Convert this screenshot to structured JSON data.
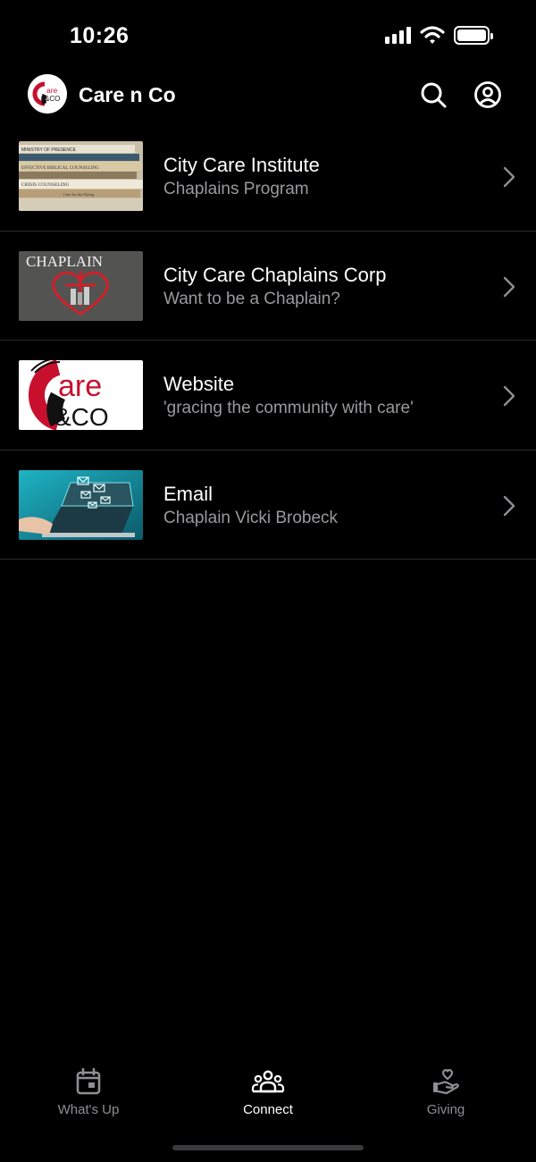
{
  "status_bar": {
    "time": "10:26"
  },
  "header": {
    "app_name": "Care n Co",
    "logo_text_top": "are",
    "logo_text_bottom": "&CO"
  },
  "list": [
    {
      "title": "City Care Institute",
      "subtitle": "Chaplains Program",
      "thumbnail": "books-stack"
    },
    {
      "title": "City Care Chaplains Corp",
      "subtitle": "Want to be a Chaplain?",
      "thumbnail": "chaplain-heart",
      "thumb_text": "CHAPLAIN"
    },
    {
      "title": "Website",
      "subtitle": "'gracing the community with care'",
      "thumbnail": "care-and-co-logo",
      "thumb_text_top": "are",
      "thumb_text_bottom": "&CO"
    },
    {
      "title": "Email",
      "subtitle": "Chaplain Vicki Brobeck",
      "thumbnail": "laptop-email"
    }
  ],
  "books": [
    "MINISTRY OF PRESENCE",
    "EFFECTIVE BIBLICAL COUNSELING",
    "CRISIS COUNSELING",
    "Care for the Dying"
  ],
  "tabs": [
    {
      "label": "What's Up",
      "icon": "calendar-icon",
      "active": false
    },
    {
      "label": "Connect",
      "icon": "people-icon",
      "active": true
    },
    {
      "label": "Giving",
      "icon": "hand-heart-icon",
      "active": false
    }
  ],
  "colors": {
    "background": "#000000",
    "text": "#ffffff",
    "subtitle": "#9a9a9e",
    "divider": "#2c2c2e",
    "inactive_tab": "#8e8e93",
    "brand_red": "#c8102e"
  }
}
